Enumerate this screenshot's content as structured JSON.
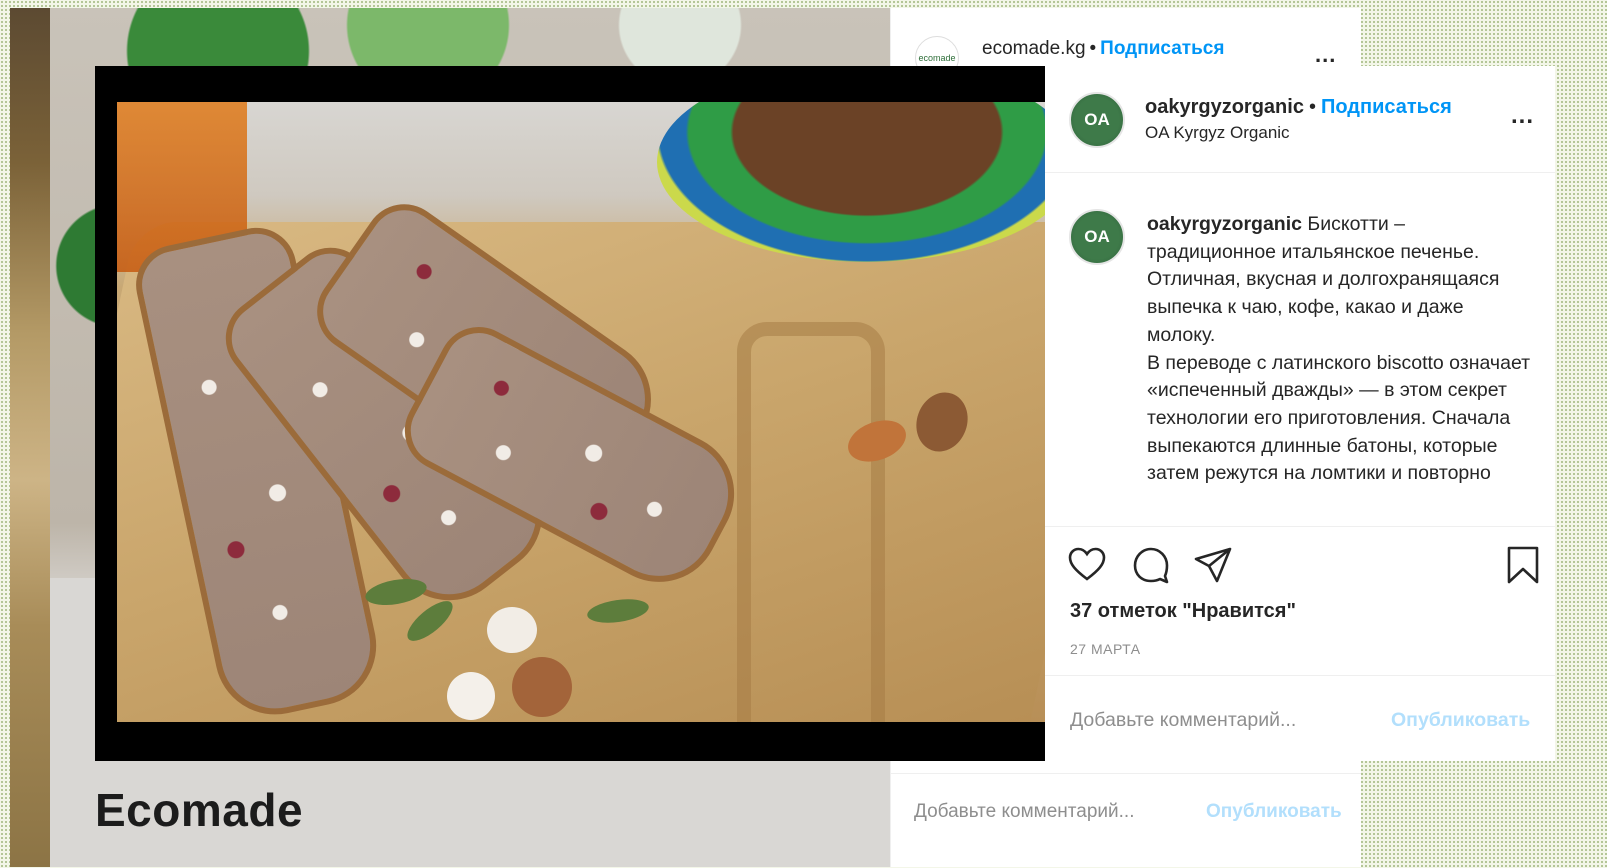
{
  "back_post": {
    "username": "ecomade.kg",
    "separator": "•",
    "follow_label": "Подписаться",
    "avatar_text": "ecomade",
    "more_label": "...",
    "brand_text": "Ecomade",
    "comment_placeholder": "Добавьте комментарий...",
    "publish_label": "Опубликовать"
  },
  "front_post": {
    "username": "oakyrgyzorganic",
    "separator": "•",
    "follow_label": "Подписаться",
    "subtitle": "OA Kyrgyz Organic",
    "avatar_text": "OA",
    "more_label": "...",
    "caption": {
      "author": "oakyrgyzorganic",
      "text": "Бискотти – традиционное итальянское печенье. Отличная, вкусная и долгохранящаяся выпечка к чаю, кофе, какао и даже молоку.\nВ переводе с латинского biscotto означает «испеченный дважды» — в этом секрет технологии его приготовления. Сначала выпекаются длинные батоны, которые затем режутся на ломтики и повторно"
    },
    "actions": {
      "like_icon": "heart-icon",
      "comment_icon": "comment-icon",
      "share_icon": "send-icon",
      "save_icon": "bookmark-icon"
    },
    "likes": "37 отметок \"Нравится\"",
    "date": "27 МАРТА",
    "comment_placeholder": "Добавьте комментарий...",
    "publish_label": "Опубликовать"
  },
  "colors": {
    "link_blue": "#0095f6",
    "publish_disabled": "#b2dffc",
    "text": "#262626",
    "muted": "#8e8e8e"
  }
}
